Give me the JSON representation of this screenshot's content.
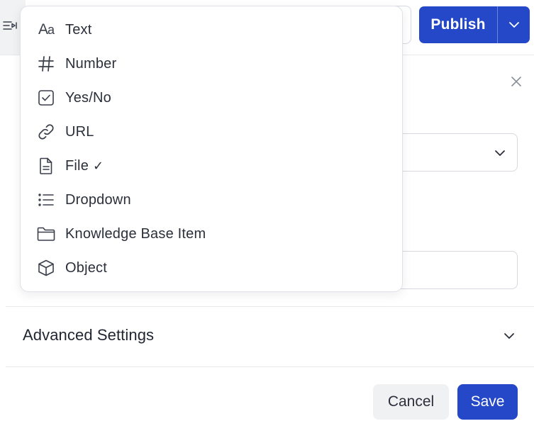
{
  "header": {
    "publish_label": "Publish",
    "toolbar_icon": "list-indent-icon",
    "publish_menu_icon": "chevron-down-icon"
  },
  "panel": {
    "close_icon": "close-icon",
    "advanced_settings_label": "Advanced Settings",
    "cancel_label": "Cancel",
    "save_label": "Save"
  },
  "type_menu": {
    "items": [
      {
        "label": "Text",
        "icon": "text-type-icon"
      },
      {
        "label": "Number",
        "icon": "hash-icon"
      },
      {
        "label": "Yes/No",
        "icon": "checkbox-icon"
      },
      {
        "label": "URL",
        "icon": "link-icon"
      },
      {
        "label": "File",
        "icon": "file-icon",
        "selected_mark": "✓"
      },
      {
        "label": "Dropdown",
        "icon": "list-icon"
      },
      {
        "label": "Knowledge Base Item",
        "icon": "folder-icon"
      },
      {
        "label": "Object",
        "icon": "cube-icon"
      }
    ]
  },
  "colors": {
    "primary": "#2448c7",
    "text": "#2a2f3a",
    "border": "#d6d9df"
  }
}
